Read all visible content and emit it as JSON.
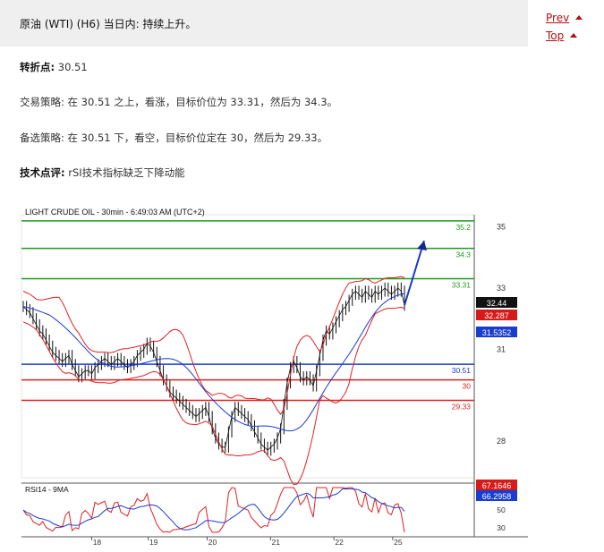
{
  "header": {
    "title": "原油 (WTI) (H6) 当日内: 持续上升。"
  },
  "nav": {
    "prev": "Prev",
    "top": "Top"
  },
  "pivot": {
    "label": "转折点:",
    "value": "30.51"
  },
  "strategy": {
    "label": "交易策略:",
    "text": "在 30.51 之上，看涨，目标价位为 33.31，然后为 34.3。"
  },
  "alternative": {
    "label": "备选策略:",
    "text": "在 30.51 下，看空，目标价位定在 30，然后为 29.33。"
  },
  "comment": {
    "label": "技术点评:",
    "text": "rSI技术指标缺乏下降动能"
  },
  "chart_data": {
    "type": "candlestick",
    "title": "LIGHT CRUDE OIL - 30min - 6:49:03 AM (UTC+2)",
    "x_tick_labels": [
      "18",
      "19",
      "20",
      "21",
      "22",
      "25"
    ],
    "y_tick_labels": [
      "35",
      "33",
      "31",
      "28"
    ],
    "ylim": [
      26.8,
      35.4
    ],
    "close_series": [
      32.4,
      32.3,
      32.2,
      32.0,
      31.8,
      31.6,
      31.5,
      31.3,
      31.1,
      30.9,
      30.8,
      30.7,
      30.6,
      30.7,
      30.8,
      30.5,
      30.3,
      30.1,
      30.2,
      30.3,
      30.3,
      30.2,
      30.4,
      30.5,
      30.6,
      30.7,
      30.6,
      30.5,
      30.6,
      30.7,
      30.6,
      30.5,
      30.4,
      30.5,
      30.6,
      30.8,
      30.9,
      31.0,
      31.2,
      31.1,
      30.9,
      30.6,
      30.3,
      30.0,
      29.8,
      29.6,
      29.5,
      29.4,
      29.3,
      29.2,
      29.1,
      29.0,
      28.9,
      28.8,
      28.9,
      29.0,
      29.1,
      28.8,
      28.4,
      28.1,
      27.9,
      27.8,
      27.8,
      28.3,
      28.8,
      29.1,
      29.0,
      28.9,
      28.8,
      28.7,
      28.5,
      28.3,
      28.1,
      27.9,
      27.8,
      27.7,
      27.8,
      27.9,
      28.1,
      28.4,
      29.2,
      29.9,
      30.4,
      30.6,
      30.4,
      30.1,
      30.0,
      30.1,
      30.0,
      29.8,
      30.3,
      30.8,
      31.3,
      31.6,
      31.5,
      31.7,
      31.9,
      32.1,
      32.3,
      32.4,
      32.6,
      32.8,
      32.9,
      32.8,
      32.7,
      32.9,
      32.8,
      32.7,
      32.9,
      32.8,
      32.9,
      33.0,
      32.9,
      32.8,
      32.9,
      33.0,
      32.9,
      32.44
    ],
    "price_levels": [
      {
        "value": 35.2,
        "label": "35.2",
        "color": "#1f9a1f"
      },
      {
        "value": 34.3,
        "label": "34.3",
        "color": "#1f9a1f"
      },
      {
        "value": 33.31,
        "label": "33.31",
        "color": "#1f9a1f"
      },
      {
        "value": 30.51,
        "label": "30.51",
        "color": "#1a3ccf"
      },
      {
        "value": 30.0,
        "label": "30",
        "color": "#e02020"
      },
      {
        "value": 29.33,
        "label": "29.33",
        "color": "#e02020"
      }
    ],
    "price_boxes": [
      {
        "label": "32.44",
        "color": "#111111"
      },
      {
        "label": "32.287",
        "color": "#d61a1a"
      },
      {
        "label": "31.5352",
        "color": "#1a3ccf"
      }
    ],
    "rsi": {
      "title": "RSI14 - 9MA",
      "ylim": [
        20,
        80
      ],
      "y_tick_labels": [
        "70",
        "50",
        "30"
      ],
      "boxes": [
        {
          "label": "67.1646",
          "color": "#d61a1a"
        },
        {
          "label": "66.2958",
          "color": "#1a3ccf"
        }
      ]
    },
    "colors": {
      "price": "#111111",
      "bollinger": "#e02020",
      "ma": "#1a3ccf",
      "arrow": "#1a3ccf"
    }
  }
}
